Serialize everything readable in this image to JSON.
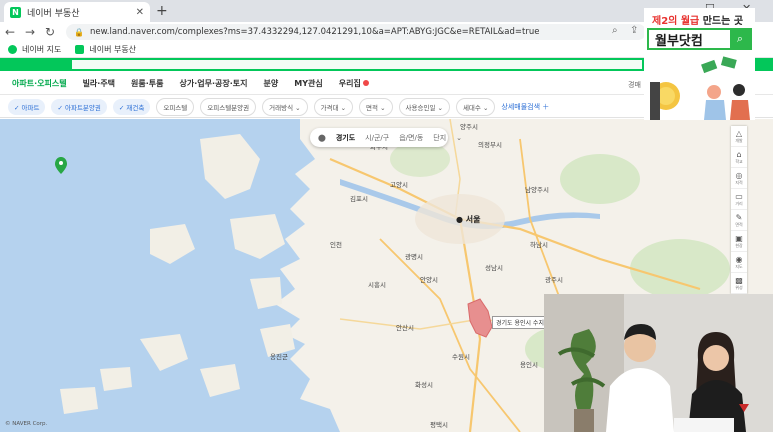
{
  "browser": {
    "tab_title": "네이버 부동산",
    "tab_favicon": "N",
    "url": "new.land.naver.com/complexes?ms=37.4332294,127.0421291,10&a=APT:ABYG:JGC&e=RETAIL&ad=true",
    "bookmarks": [
      {
        "label": "네이버 지도",
        "icon": "map-icon",
        "color": "#03c75a"
      },
      {
        "label": "네이버 부동산",
        "icon": "naver-icon",
        "color": "#03c75a"
      }
    ]
  },
  "menu": {
    "items": [
      {
        "label": "아파트·오피스텔",
        "active": true
      },
      {
        "label": "빌라·주택",
        "active": false
      },
      {
        "label": "원룸·투룸",
        "active": false
      },
      {
        "label": "상가·업무·공장·토지",
        "active": false
      },
      {
        "label": "분양",
        "active": false
      },
      {
        "label": "MY관심",
        "active": false
      },
      {
        "label": "우리집",
        "active": false,
        "badge": true
      }
    ],
    "right_label": "경매"
  },
  "filters": {
    "chips": [
      {
        "label": "아파트",
        "on": true
      },
      {
        "label": "아파트분양권",
        "on": true
      },
      {
        "label": "재건축",
        "on": true
      },
      {
        "label": "오피스텔",
        "on": false
      },
      {
        "label": "오피스텔분양권",
        "on": false
      },
      {
        "label": "거래방식",
        "on": false
      },
      {
        "label": "가격대",
        "on": false
      },
      {
        "label": "면적",
        "on": false
      },
      {
        "label": "사용승인일",
        "on": false
      },
      {
        "label": "세대수",
        "on": false
      }
    ],
    "add_label": "상세매물검색"
  },
  "location_bar": {
    "region": "경기도",
    "district": "시/군/구",
    "town": "읍/면/동",
    "complex": "단지"
  },
  "map": {
    "labels": [
      {
        "text": "김포시"
      },
      {
        "text": "고양시"
      },
      {
        "text": "의정부시"
      },
      {
        "text": "양주시"
      },
      {
        "text": "남양주시"
      },
      {
        "text": "서울"
      },
      {
        "text": "인천"
      },
      {
        "text": "광명시"
      },
      {
        "text": "시흥시"
      },
      {
        "text": "안양시"
      },
      {
        "text": "성남시"
      },
      {
        "text": "하남시"
      },
      {
        "text": "광주시"
      },
      {
        "text": "안산시"
      },
      {
        "text": "수원시"
      },
      {
        "text": "화성시"
      },
      {
        "text": "평택시"
      },
      {
        "text": "용인시"
      },
      {
        "text": "옹진군"
      },
      {
        "text": "파주시"
      }
    ],
    "tooltip": "경기도 용인시 수지구",
    "copyright": "© NAVER Corp."
  },
  "toolbar": {
    "tools": [
      {
        "label": "개발",
        "icon": "warning-icon"
      },
      {
        "label": "학교",
        "icon": "school-icon"
      },
      {
        "label": "지적",
        "icon": "layers-icon"
      },
      {
        "label": "거리",
        "icon": "ruler-icon"
      },
      {
        "label": "면적",
        "icon": "area-icon"
      },
      {
        "label": "현장",
        "icon": "camera-icon"
      },
      {
        "label": "지도",
        "icon": "pin-icon"
      },
      {
        "label": "위성",
        "icon": "satellite-icon"
      }
    ]
  },
  "ad": {
    "line1_red": "제2의 월급",
    "line1_rest": "만드는 곳",
    "brand": "월부닷컴"
  },
  "colors": {
    "naver_green": "#03c75a",
    "sea": "#b5d2ee",
    "land": "#f4f1ea",
    "highlight": "#e78f8f",
    "ad_green": "#2db84b"
  }
}
